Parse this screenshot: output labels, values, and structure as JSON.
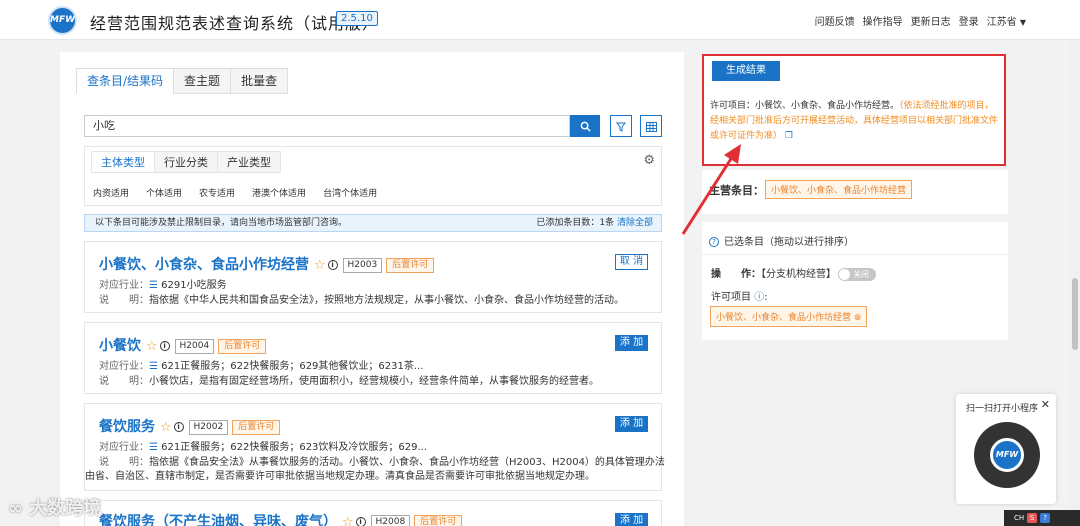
{
  "header": {
    "logo": "MFW",
    "title": "经营范围规范表述查询系统（试用版）",
    "version": "2.5.10",
    "nav": [
      "问题反馈",
      "操作指导",
      "更新日志",
      "登录"
    ],
    "region": "江苏省"
  },
  "tabs": [
    "查条目/结果码",
    "查主题",
    "批量查"
  ],
  "search": {
    "value": "小吃"
  },
  "filter": {
    "tabs": [
      "主体类型",
      "行业分类",
      "产业类型"
    ],
    "chips": [
      "内资适用",
      "个体适用",
      "农专适用",
      "港澳个体适用",
      "台湾个体适用"
    ]
  },
  "notice": {
    "text": "以下条目可能涉及禁止限制目录，请向当地市场监管部门咨询。",
    "count": "已添加条目数：1条",
    "clear": "清除全部"
  },
  "results": [
    {
      "title": "小餐饮、小食杂、食品小作坊经营",
      "code": "H2003",
      "tag": "后置许可",
      "industry_label": "对应行业：",
      "industry": "6291小吃服务",
      "desc_label": "说　　明：",
      "desc": "指依据《中华人民共和国食品安全法》，按照地方法规规定，从事小餐饮、小食杂、食品小作坊经营的活动。",
      "action": "取 消"
    },
    {
      "title": "小餐饮",
      "code": "H2004",
      "tag": "后置许可",
      "industry_label": "对应行业：",
      "industry": "621正餐服务；622快餐服务；629其他餐饮业；6231茶...",
      "desc_label": "说　　明：",
      "desc": "小餐饮店，是指有固定经营场所，使用面积小，经营规模小，经营条件简单，从事餐饮服务的经营者。",
      "action": "添 加"
    },
    {
      "title": "餐饮服务",
      "code": "H2002",
      "tag": "后置许可",
      "industry_label": "对应行业：",
      "industry": "621正餐服务；622快餐服务；623饮料及冷饮服务；629...",
      "desc_label": "说　　明：",
      "desc": "指依据《食品安全法》从事餐饮服务的活动。小餐饮、小食杂、食品小作坊经营（H2003、H2004）的具体管理办法",
      "desc2": "由省、自治区、直辖市制定，是否需要许可审批依据当地规定办理。清真食品是否需要许可审批依据当地规定办理。",
      "action": "添 加"
    },
    {
      "title": "餐饮服务（不产生油烟、异味、废气）",
      "code": "H2008",
      "tag": "后置许可",
      "action": "添 加"
    }
  ],
  "result_panel": {
    "button": "生成结果",
    "label": "许可项目：",
    "value": "小餐饮、小食杂、食品小作坊经营。",
    "note": "（依法须经批准的项目，经相关部门批准后方可开展经营活动，具体经营项目以相关部门批准文件或许可证件为准）"
  },
  "main_item": {
    "label": "主营条目：",
    "value": "小餐饮、小食杂、食品小作坊经营"
  },
  "selected": {
    "heading": "已选条目（拖动以进行排序）",
    "op_label": "操　　作：",
    "op_value": "【分支机构经营】",
    "toggle": "关闭",
    "lic_label": "许可项目",
    "lic_value": "小餐饮、小食杂、食品小作坊经营"
  },
  "qr": {
    "title": "扫一扫打开小程序"
  },
  "watermark": "大数跨境",
  "tray": [
    "CH",
    "S",
    "?"
  ],
  "colors": {
    "primary": "#1a73c7",
    "orange": "#e8842e",
    "highlight": "#e03036"
  }
}
